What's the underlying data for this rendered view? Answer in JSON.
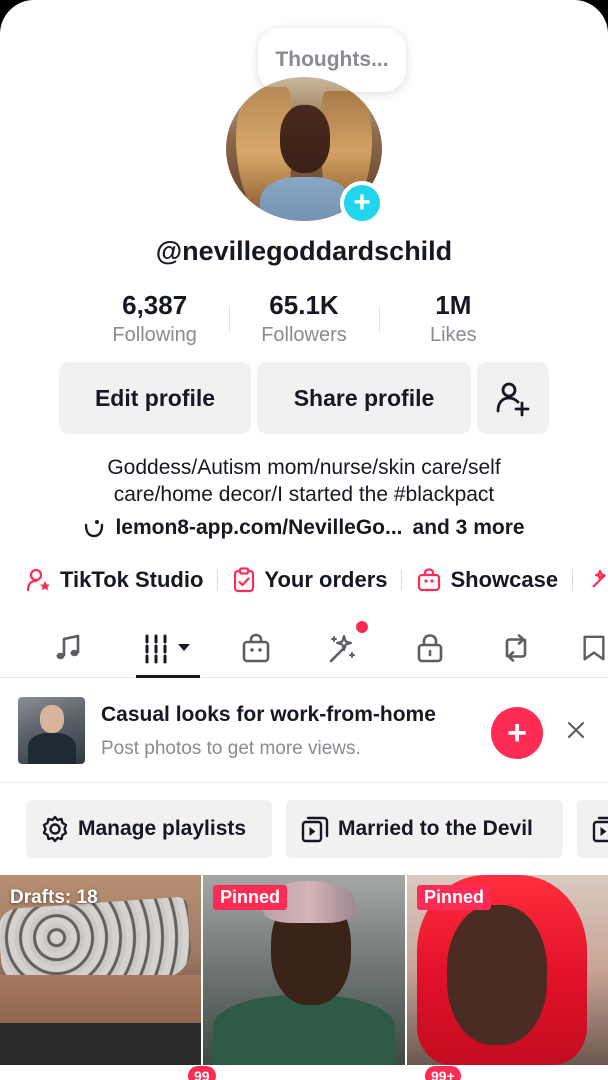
{
  "profile": {
    "thought_bubble": "Thoughts...",
    "username": "@nevillegoddardschild",
    "stats": [
      {
        "value": "6,387",
        "label": "Following"
      },
      {
        "value": "65.1K",
        "label": "Followers"
      },
      {
        "value": "1M",
        "label": "Likes"
      }
    ],
    "edit_label": "Edit profile",
    "share_label": "Share profile",
    "bio_line1": "Goddess/Autism mom/nurse/skin care/self",
    "bio_line2": "care/home decor/I started the #blackpact",
    "link_text": "lemon8-app.com/NevilleGo...",
    "link_more": "and 3 more"
  },
  "shortcuts": {
    "studio": "TikTok Studio",
    "orders": "Your orders",
    "showcase": "Showcase"
  },
  "tabs": {
    "icons": [
      "music-note-icon",
      "grid-dropdown-icon",
      "shop-bag-icon",
      "magic-wand-icon",
      "lock-icon",
      "repost-icon",
      "favorites-icon"
    ]
  },
  "promo": {
    "title": "Casual looks for work-from-home",
    "subtitle": "Post photos to get more views."
  },
  "playlists": {
    "manage": "Manage playlists",
    "married": "Married to the Devil"
  },
  "grid": {
    "drafts": "Drafts: 18",
    "pinned1": "Pinned",
    "pinned2": "Pinned"
  },
  "bottom_nav": {
    "badge1": "99",
    "badge2": "99+"
  },
  "colors": {
    "accent_red": "#fe2c55",
    "accent_cyan": "#20d5ec",
    "text_primary": "#161823",
    "text_secondary": "#8a8b91"
  }
}
